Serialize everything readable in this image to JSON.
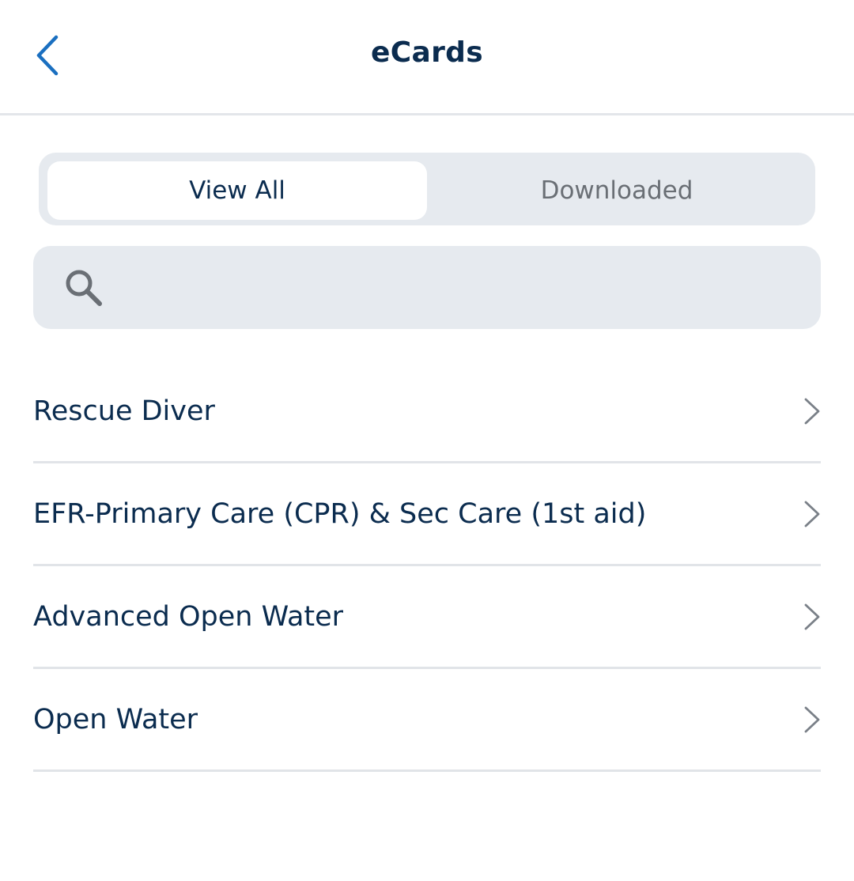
{
  "header": {
    "title": "eCards",
    "back_icon": "chevron-left-icon"
  },
  "tabs": [
    {
      "label": "View All",
      "selected": true
    },
    {
      "label": "Downloaded",
      "selected": false
    }
  ],
  "search": {
    "icon": "search-icon",
    "value": "",
    "placeholder": ""
  },
  "ecards": [
    {
      "label": "Rescue Diver"
    },
    {
      "label": "EFR-Primary Care (CPR) & Sec Care (1st aid)"
    },
    {
      "label": "Advanced Open Water"
    },
    {
      "label": "Open Water"
    }
  ],
  "colors": {
    "accent": "#1a6fc0",
    "text_primary": "#0b2c4f",
    "text_secondary": "#6a6f75",
    "control_bg": "#e6eaef",
    "divider": "#e1e4e8"
  }
}
